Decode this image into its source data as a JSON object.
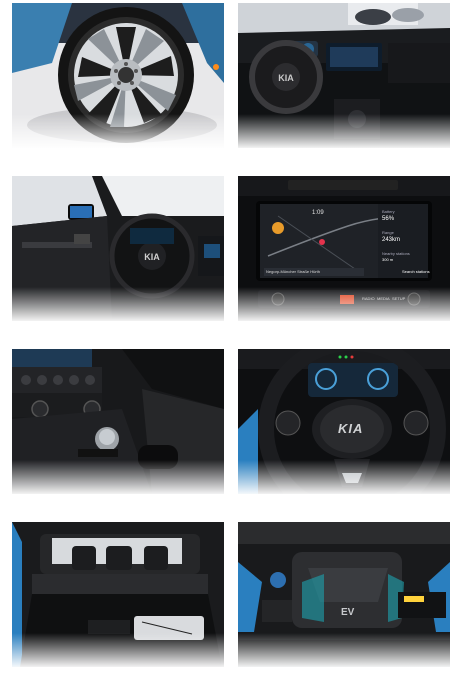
{
  "photos": [
    {
      "name": "wheel"
    },
    {
      "name": "dashboard"
    },
    {
      "name": "driver-door"
    },
    {
      "name": "navigation-screen",
      "screen": {
        "time": "1:09",
        "battery_label": "Battery",
        "battery_value": "56",
        "battery_unit": "%",
        "range_label": "Range",
        "range_value": "243",
        "range_unit": "km",
        "nearby_label": "Nearby stations",
        "nearby_value": "300 m",
        "search_label": "Search stations",
        "address_text": "Negorp-Müncher Straße Hürth",
        "buttons": [
          "RADIO",
          "MEDIA",
          "SETUP"
        ]
      }
    },
    {
      "name": "center-console"
    },
    {
      "name": "steering-wheel",
      "logo": "KIA"
    },
    {
      "name": "trunk"
    },
    {
      "name": "engine-bay",
      "badge": "EV"
    }
  ]
}
